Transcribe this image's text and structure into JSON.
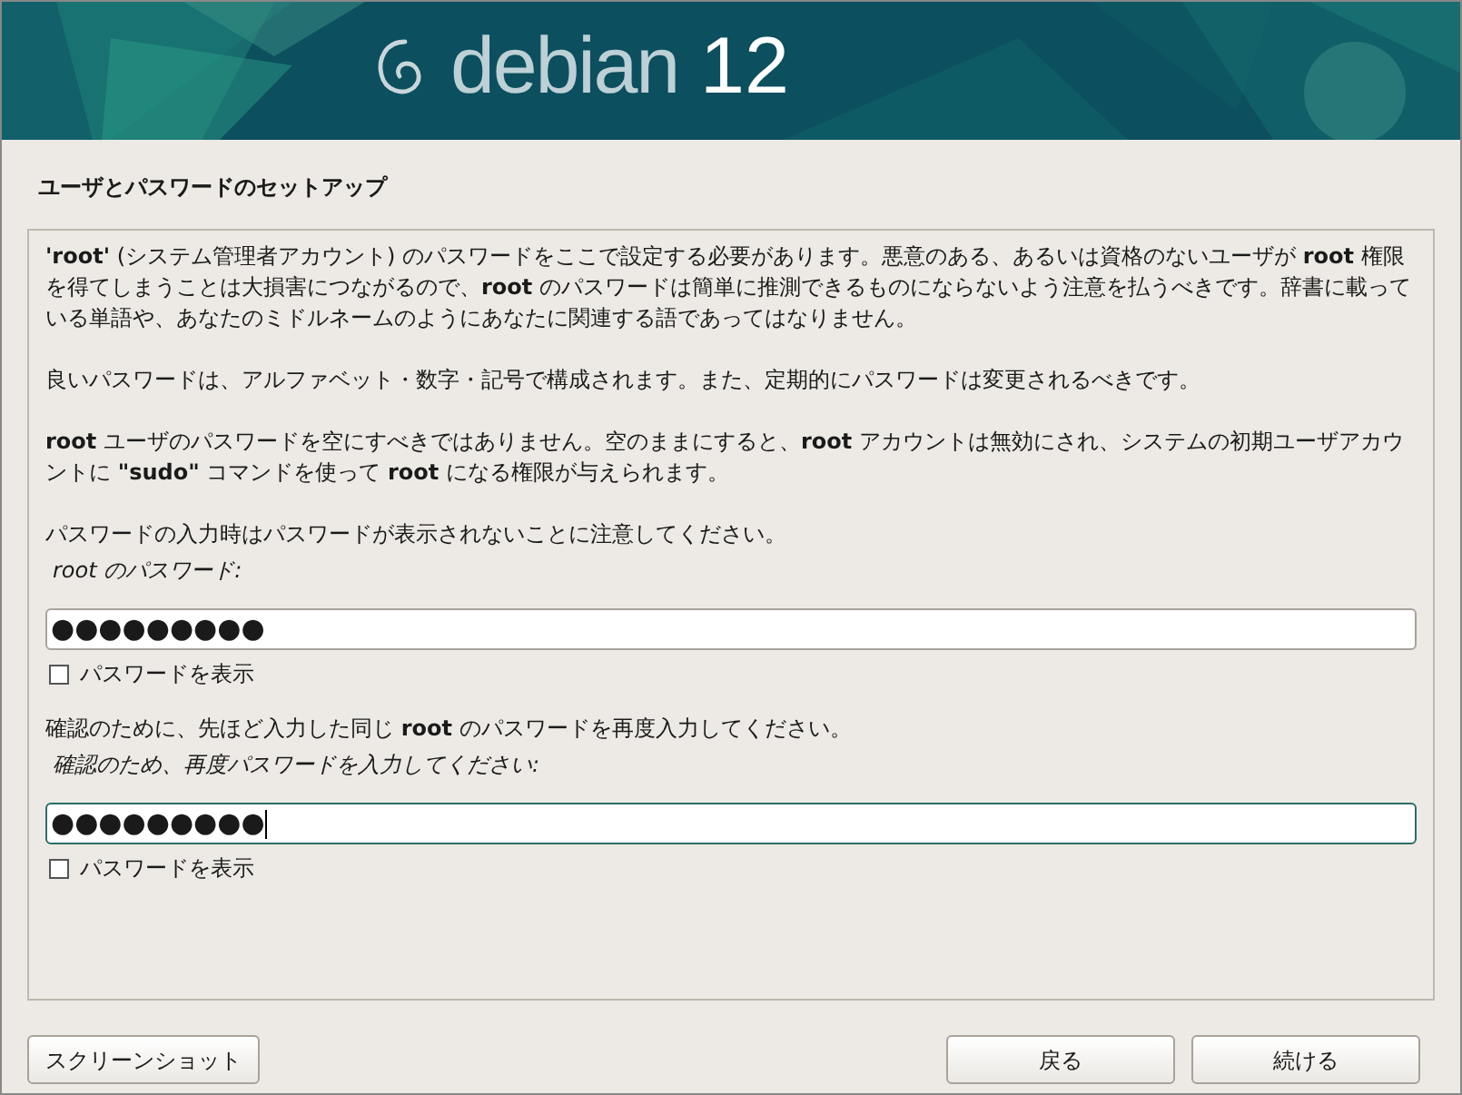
{
  "banner": {
    "logo_text": "debian",
    "version": "12"
  },
  "title": "ユーザとパスワードのセットアップ",
  "paragraphs": [
    "**'root'** (システム管理者アカウント) のパスワードをここで設定する必要があります。悪意のある、あるいは資格のないユーザが **root** 権限を得てしまうことは大損害につながるので、**root** のパスワードは簡単に推測できるものにならないよう注意を払うべきです。辞書に載っている単語や、あなたのミドルネームのようにあなたに関連する語であってはなりません。",
    "良いパスワードは、アルファベット・数字・記号で構成されます。また、定期的にパスワードは変更されるべきです。",
    "**root** ユーザのパスワードを空にすべきではありません。空のままにすると、**root** アカウントは無効にされ、システムの初期ユーザアカウントに **\"sudo\"** コマンドを使って **root** になる権限が与えられます。",
    "パスワードの入力時はパスワードが表示されないことに注意してください。"
  ],
  "fields": [
    {
      "label": "root のパスワード:",
      "value": "●●●●●●●●●",
      "focused": false,
      "show_password": {
        "label": "パスワードを表示",
        "checked": false
      }
    },
    {
      "intro": "確認のために、先ほど入力した同じ **root** のパスワードを再度入力してください。",
      "label": "確認のため、再度パスワードを入力してください:",
      "value": "●●●●●●●●●",
      "focused": true,
      "show_password": {
        "label": "パスワードを表示",
        "checked": false
      }
    }
  ],
  "buttons": [
    {
      "label": "スクリーンショット",
      "kind": "left"
    },
    {
      "label": "戻る",
      "kind": "right"
    },
    {
      "label": "続ける",
      "kind": "right"
    }
  ]
}
